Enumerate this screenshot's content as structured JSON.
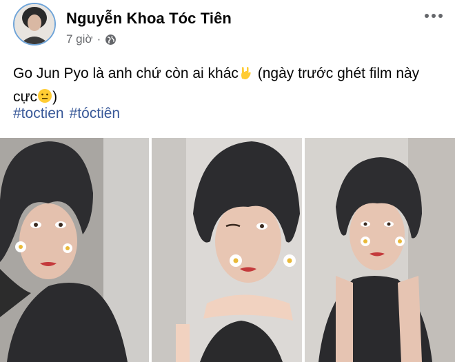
{
  "post": {
    "author": "Nguyễn Khoa Tóc Tiên",
    "time": "7 giờ",
    "separator": "·",
    "caption_part1": "Go Jun Pyo là anh chứ còn ai khác",
    "caption_part2": " (ngày trước ghét film này cực",
    "caption_part3": ")",
    "hashtags": [
      "#toctien",
      "#tóctiên"
    ]
  },
  "icons": {
    "more": "more-horizontal-icon",
    "audience": "globe-icon",
    "emoji1": "rock-on-hand-emoji",
    "emoji2": "neutral-face-emoji"
  },
  "colors": {
    "name": "#050505",
    "meta": "#65676b",
    "hashtag": "#385898",
    "avatar_ring": "#6fa4d8"
  }
}
